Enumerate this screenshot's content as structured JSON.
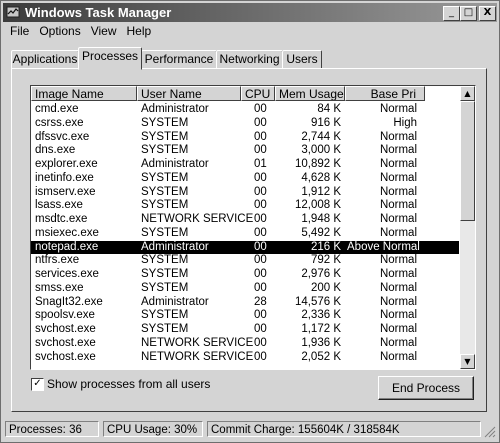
{
  "window": {
    "title": "Windows Task Manager",
    "min_label": "_",
    "max_label": "□",
    "close_label": "X"
  },
  "menu": [
    "File",
    "Options",
    "View",
    "Help"
  ],
  "tabs": [
    "Applications",
    "Processes",
    "Performance",
    "Networking",
    "Users"
  ],
  "active_tab": "Processes",
  "columns": [
    "Image Name",
    "User Name",
    "CPU",
    "Mem Usage",
    "Base Pri"
  ],
  "processes": [
    {
      "image": "cmd.exe",
      "user": "Administrator",
      "cpu": "00",
      "mem": "84 K",
      "pri": "Normal"
    },
    {
      "image": "csrss.exe",
      "user": "SYSTEM",
      "cpu": "00",
      "mem": "916 K",
      "pri": "High"
    },
    {
      "image": "dfssvc.exe",
      "user": "SYSTEM",
      "cpu": "00",
      "mem": "2,744 K",
      "pri": "Normal"
    },
    {
      "image": "dns.exe",
      "user": "SYSTEM",
      "cpu": "00",
      "mem": "3,000 K",
      "pri": "Normal"
    },
    {
      "image": "explorer.exe",
      "user": "Administrator",
      "cpu": "01",
      "mem": "10,892 K",
      "pri": "Normal"
    },
    {
      "image": "inetinfo.exe",
      "user": "SYSTEM",
      "cpu": "00",
      "mem": "4,628 K",
      "pri": "Normal"
    },
    {
      "image": "ismserv.exe",
      "user": "SYSTEM",
      "cpu": "00",
      "mem": "1,912 K",
      "pri": "Normal"
    },
    {
      "image": "lsass.exe",
      "user": "SYSTEM",
      "cpu": "00",
      "mem": "12,008 K",
      "pri": "Normal"
    },
    {
      "image": "msdtc.exe",
      "user": "NETWORK SERVICE",
      "cpu": "00",
      "mem": "1,948 K",
      "pri": "Normal"
    },
    {
      "image": "msiexec.exe",
      "user": "SYSTEM",
      "cpu": "00",
      "mem": "5,492 K",
      "pri": "Normal"
    },
    {
      "image": "notepad.exe",
      "user": "Administrator",
      "cpu": "00",
      "mem": "216 K",
      "pri": "Above Normal",
      "selected": true
    },
    {
      "image": "ntfrs.exe",
      "user": "SYSTEM",
      "cpu": "00",
      "mem": "792 K",
      "pri": "Normal"
    },
    {
      "image": "services.exe",
      "user": "SYSTEM",
      "cpu": "00",
      "mem": "2,976 K",
      "pri": "Normal"
    },
    {
      "image": "smss.exe",
      "user": "SYSTEM",
      "cpu": "00",
      "mem": "200 K",
      "pri": "Normal"
    },
    {
      "image": "SnagIt32.exe",
      "user": "Administrator",
      "cpu": "28",
      "mem": "14,576 K",
      "pri": "Normal"
    },
    {
      "image": "spoolsv.exe",
      "user": "SYSTEM",
      "cpu": "00",
      "mem": "2,336 K",
      "pri": "Normal"
    },
    {
      "image": "svchost.exe",
      "user": "SYSTEM",
      "cpu": "00",
      "mem": "1,172 K",
      "pri": "Normal"
    },
    {
      "image": "svchost.exe",
      "user": "NETWORK SERVICE",
      "cpu": "00",
      "mem": "1,936 K",
      "pri": "Normal"
    },
    {
      "image": "svchost.exe",
      "user": "NETWORK SERVICE",
      "cpu": "00",
      "mem": "2,052 K",
      "pri": "Normal"
    }
  ],
  "show_all_users": {
    "label": "Show processes from all users",
    "checked": true,
    "check_glyph": "✓"
  },
  "end_process_label": "End Process",
  "status": {
    "processes": "Processes: 36",
    "cpu": "CPU Usage: 30%",
    "commit": "Commit Charge: 155604K / 318584K"
  },
  "scrollbar": {
    "up_glyph": "▲",
    "down_glyph": "▼"
  }
}
